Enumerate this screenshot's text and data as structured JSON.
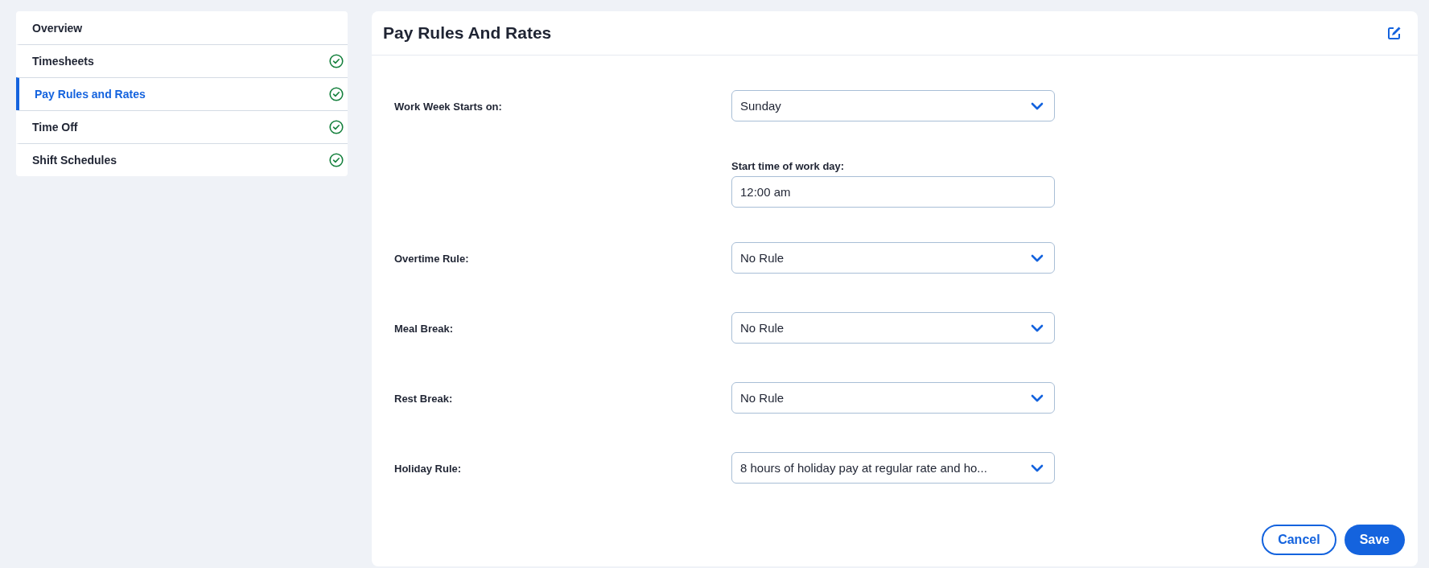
{
  "sidebar": {
    "items": [
      {
        "label": "Overview",
        "selected": false,
        "completed": false
      },
      {
        "label": "Timesheets",
        "selected": false,
        "completed": true
      },
      {
        "label": "Pay Rules and Rates",
        "selected": true,
        "completed": true
      },
      {
        "label": "Time Off",
        "selected": false,
        "completed": true
      },
      {
        "label": "Shift Schedules",
        "selected": false,
        "completed": true
      }
    ]
  },
  "panel": {
    "title": "Pay Rules And Rates",
    "fields": [
      {
        "kind": "select",
        "label": "Work Week Starts on:",
        "value": "Sunday"
      },
      {
        "kind": "time",
        "label": "Start time of work day:",
        "value": "12:00 am"
      },
      {
        "kind": "select",
        "label": "Overtime Rule:",
        "value": "No Rule"
      },
      {
        "kind": "select",
        "label": "Meal Break:",
        "value": "No Rule"
      },
      {
        "kind": "select",
        "label": "Rest Break:",
        "value": "No Rule"
      },
      {
        "kind": "select",
        "label": "Holiday Rule:",
        "value": "8 hours of holiday pay at regular rate and ho..."
      }
    ],
    "buttons": [
      {
        "kind": "secondary",
        "label": "Cancel"
      },
      {
        "kind": "primary",
        "label": "Save"
      }
    ]
  }
}
